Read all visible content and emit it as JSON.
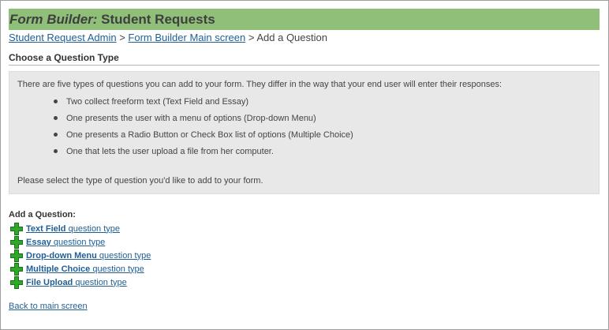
{
  "header": {
    "title_prefix": "Form Builder:",
    "title_suffix": " Student Requests"
  },
  "breadcrumb": {
    "items": [
      {
        "label": "Student Request Admin"
      },
      {
        "label": "Form Builder Main screen"
      },
      {
        "label": "Add a Question"
      }
    ],
    "separator": " > "
  },
  "section": {
    "heading": "Choose a Question Type"
  },
  "info": {
    "intro": "There are five types of questions you can add to your form. They differ in the way that your end user will enter their responses:",
    "bullets": [
      "Two collect freeform text (Text Field and Essay)",
      "One presents the user with a menu of options (Drop-down Menu)",
      "One presents a Radio Button or Check Box list of options (Multiple Choice)",
      "One that lets the user upload a file from her computer."
    ],
    "outro": "Please select the type of question you'd like to add to your form."
  },
  "add_question": {
    "heading": "Add a Question:",
    "suffix": " question type",
    "types": [
      {
        "name": "Text Field"
      },
      {
        "name": "Essay"
      },
      {
        "name": "Drop-down Menu"
      },
      {
        "name": "Multiple Choice"
      },
      {
        "name": "File Upload"
      }
    ],
    "icon": "green-plus-icon"
  },
  "footer": {
    "back_link": "Back to main screen"
  },
  "colors": {
    "title_bar": "#8fbf79",
    "link": "#1f5f96",
    "info_bg": "#e8e8e8",
    "plus_icon": "#2fa829"
  }
}
